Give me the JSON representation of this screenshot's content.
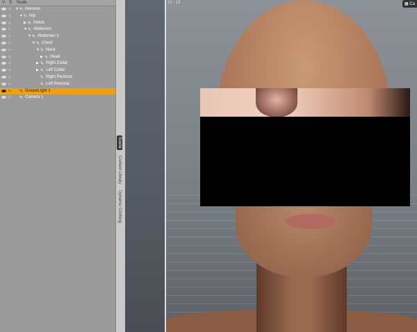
{
  "scene_panel": {
    "headers": {
      "visible": "V",
      "selectable": "S",
      "node": "Node"
    },
    "nodes": [
      {
        "label": "Genesis",
        "depth": 0,
        "expander": "▼"
      },
      {
        "label": "Hip",
        "depth": 1,
        "expander": "▼"
      },
      {
        "label": "Pelvis",
        "depth": 2,
        "expander": "▶"
      },
      {
        "label": "Abdomen",
        "depth": 2,
        "expander": "▼"
      },
      {
        "label": "Abdomen 2",
        "depth": 3,
        "expander": "▼"
      },
      {
        "label": "Chest",
        "depth": 4,
        "expander": "▼"
      },
      {
        "label": "Neck",
        "depth": 5,
        "expander": "▼"
      },
      {
        "label": "Head",
        "depth": 6,
        "expander": "▶"
      },
      {
        "label": "Right Collar",
        "depth": 5,
        "expander": "▶"
      },
      {
        "label": "Left Collar",
        "depth": 5,
        "expander": "▶"
      },
      {
        "label": "Right Pectoral",
        "depth": 5,
        "expander": ""
      },
      {
        "label": "Left Pectoral",
        "depth": 5,
        "expander": ""
      },
      {
        "label": "DistantLight 1",
        "depth": 0,
        "expander": "",
        "selected": true
      },
      {
        "label": "Camera 1",
        "depth": 0,
        "expander": ""
      }
    ]
  },
  "side_tabs": [
    "Scene",
    "Content Library",
    "Dynamic Clothing"
  ],
  "viewport": {
    "coord": "10 : 13",
    "camera_label": "Ca"
  },
  "colors": {
    "selection": "#f5a100"
  }
}
